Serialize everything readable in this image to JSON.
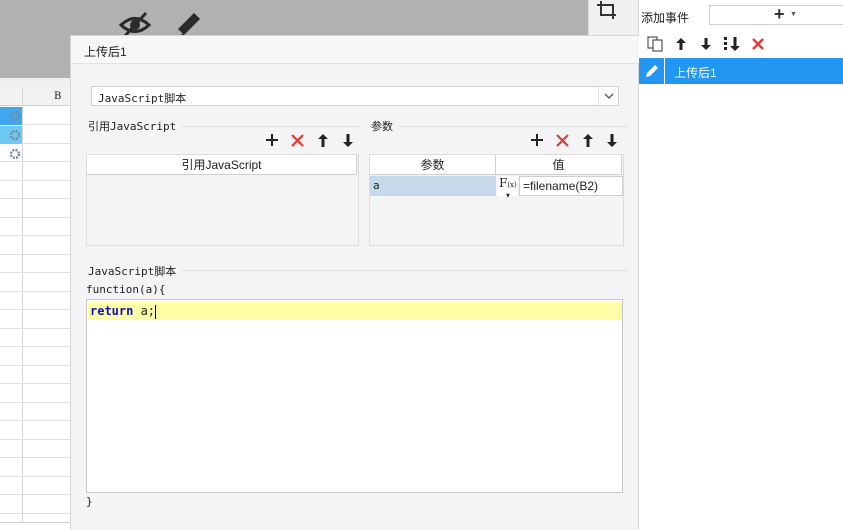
{
  "background": {
    "sheet_column_header": "B",
    "icons": [
      "visibility-off-icon",
      "pencil-icon",
      "crop-icon",
      "gear-icon"
    ]
  },
  "event_panel": {
    "add_event_label": "添加事件",
    "add_button_glyph": "+",
    "toolbar_icons": [
      "copy-icon",
      "move-up-icon",
      "move-down-icon",
      "move-to-bottom-icon",
      "delete-icon"
    ],
    "events": [
      {
        "label": "上传后1",
        "icon": "edit-icon",
        "selected": true
      }
    ],
    "selected_color": "#2196f3"
  },
  "dialog": {
    "title": "上传后1",
    "type_select": {
      "value": "JavaScript脚本"
    },
    "ref_js": {
      "title": "引用JavaScript",
      "column_header": "引用JavaScript",
      "rows": []
    },
    "params": {
      "title": "参数",
      "headers": [
        "参数",
        "值"
      ],
      "rows": [
        {
          "name": "a",
          "value": "=filename(B2)",
          "formula_icon": "F(x)"
        }
      ]
    },
    "script": {
      "title": "JavaScript脚本",
      "signature": "function(a){",
      "code_keyword": "return",
      "code_rest": " a;",
      "closing": "}"
    },
    "toolbar_icons": [
      "add-icon",
      "delete-icon",
      "move-up-icon",
      "move-down-icon"
    ],
    "delete_color": "#e53935"
  }
}
